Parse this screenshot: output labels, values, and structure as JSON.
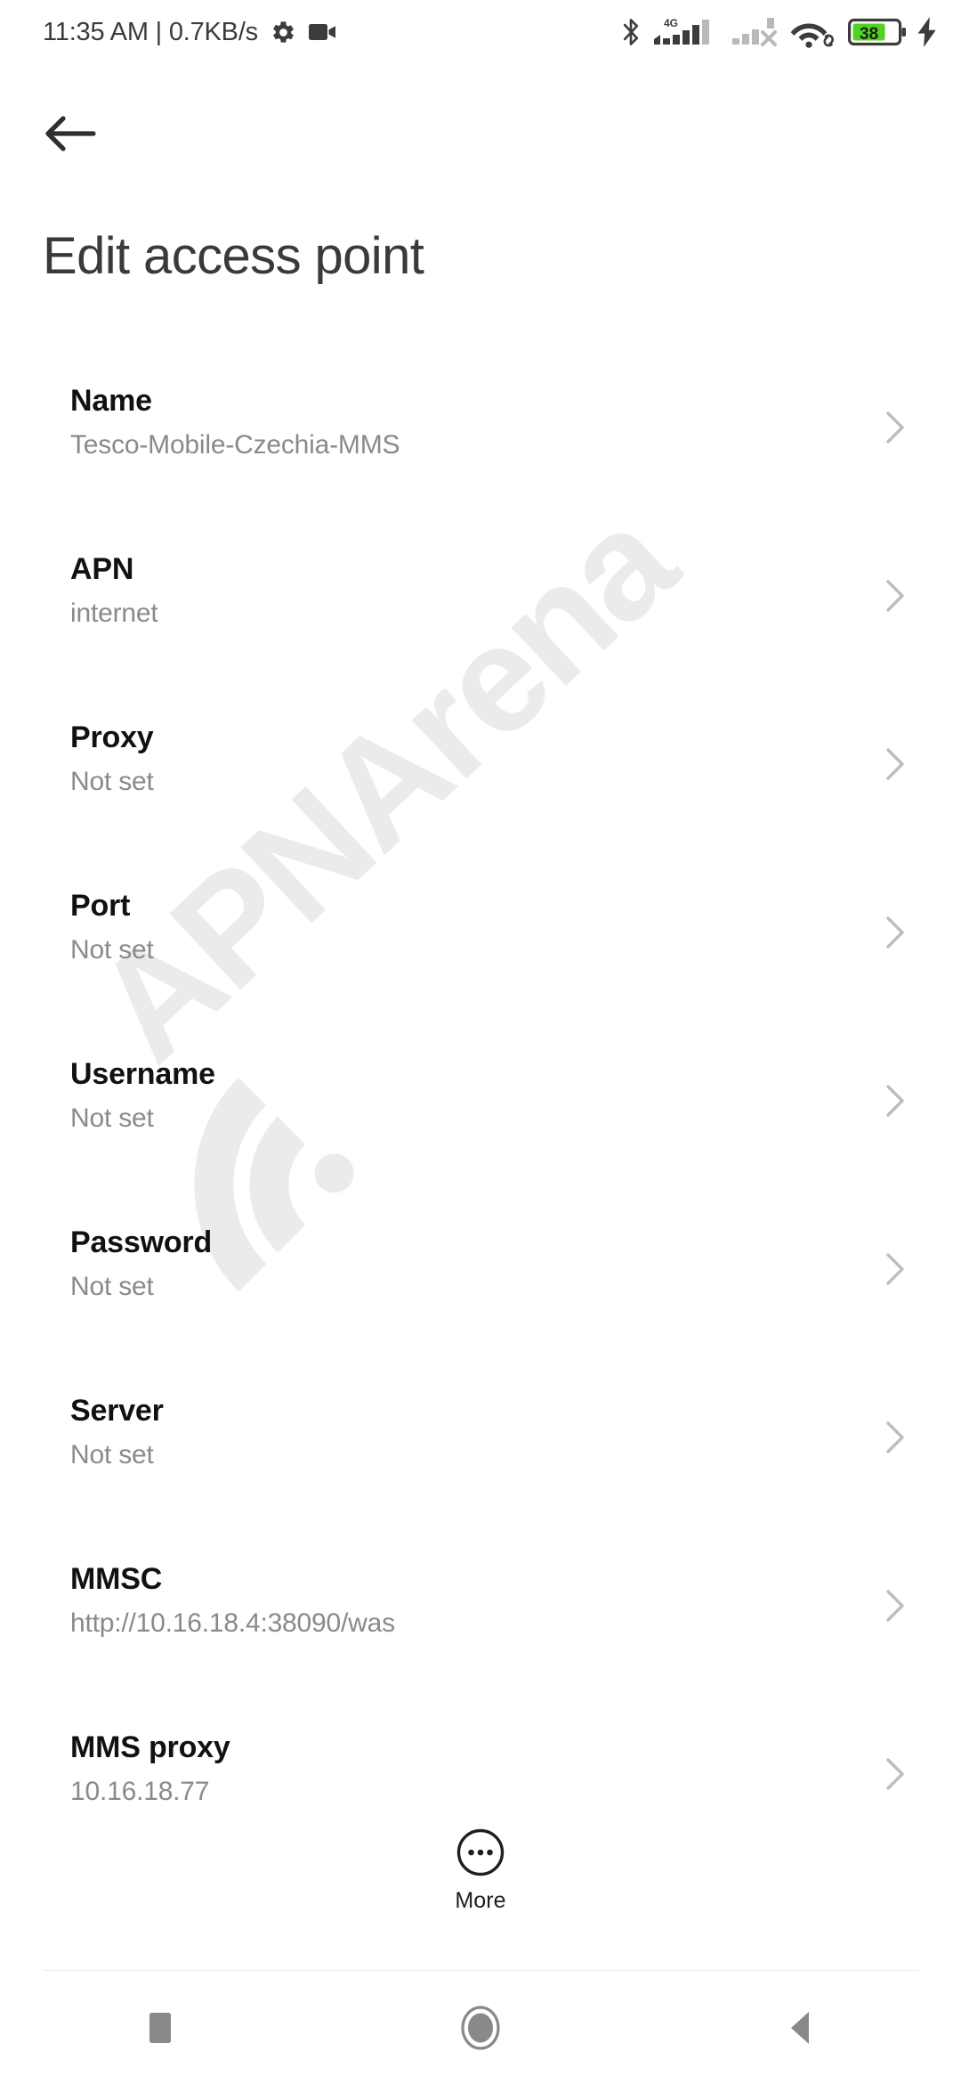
{
  "status_bar": {
    "clock_and_speed": "11:35 AM | 0.7KB/s",
    "left_icons": [
      "gear-icon",
      "video-camera-icon"
    ],
    "right_icons": [
      "bluetooth-icon",
      "signal-4g-icon",
      "signal-no-service-icon",
      "wifi-icon",
      "battery-icon",
      "charging-bolt-icon"
    ],
    "network_type": "4G",
    "battery_level": "38",
    "battery_color": "#4fd220"
  },
  "header": {
    "back_label": "Back",
    "title": "Edit access point"
  },
  "watermark": {
    "text": "APNArena",
    "color": "#ebebeb"
  },
  "settings_rows": [
    {
      "label": "Name",
      "value": "Tesco-Mobile-Czechia-MMS"
    },
    {
      "label": "APN",
      "value": "internet"
    },
    {
      "label": "Proxy",
      "value": "Not set"
    },
    {
      "label": "Port",
      "value": "Not set"
    },
    {
      "label": "Username",
      "value": "Not set"
    },
    {
      "label": "Password",
      "value": "Not set"
    },
    {
      "label": "Server",
      "value": "Not set"
    },
    {
      "label": "MMSC",
      "value": "http://10.16.18.4:38090/was"
    },
    {
      "label": "MMS proxy",
      "value": "10.16.18.77"
    }
  ],
  "more_button": {
    "label": "More",
    "icon": "overflow-dots-circle-icon"
  },
  "navigation_bar": {
    "recents_label": "Recents",
    "home_label": "Home",
    "back_label": "Back",
    "color": "#898989"
  },
  "colors": {
    "background": "#ffffff",
    "title_text": "#3a3a3a",
    "row_title": "#111111",
    "row_value": "#8a8a8a",
    "chevron": "#bdbdbd"
  }
}
